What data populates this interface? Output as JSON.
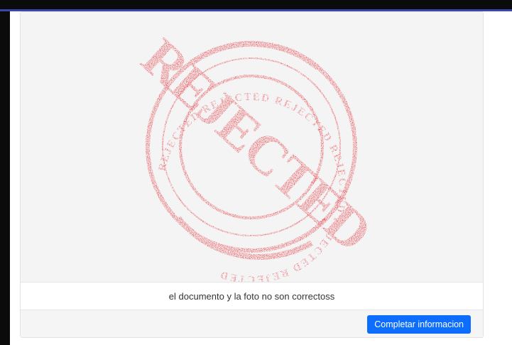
{
  "card": {
    "image": {
      "stamp_word": "REJECTED",
      "ring_text": "REJECTED REJECTED REJECTED REJECTED REJECTED REJECTED",
      "stamp_color": "#e2323a"
    },
    "message": "el documento y la foto no son correctoss",
    "button_label": "Completar informacion"
  },
  "colors": {
    "primary": "#0d6efd",
    "image_background": "#f4f4f4",
    "footer_background": "#f5f5f5"
  }
}
